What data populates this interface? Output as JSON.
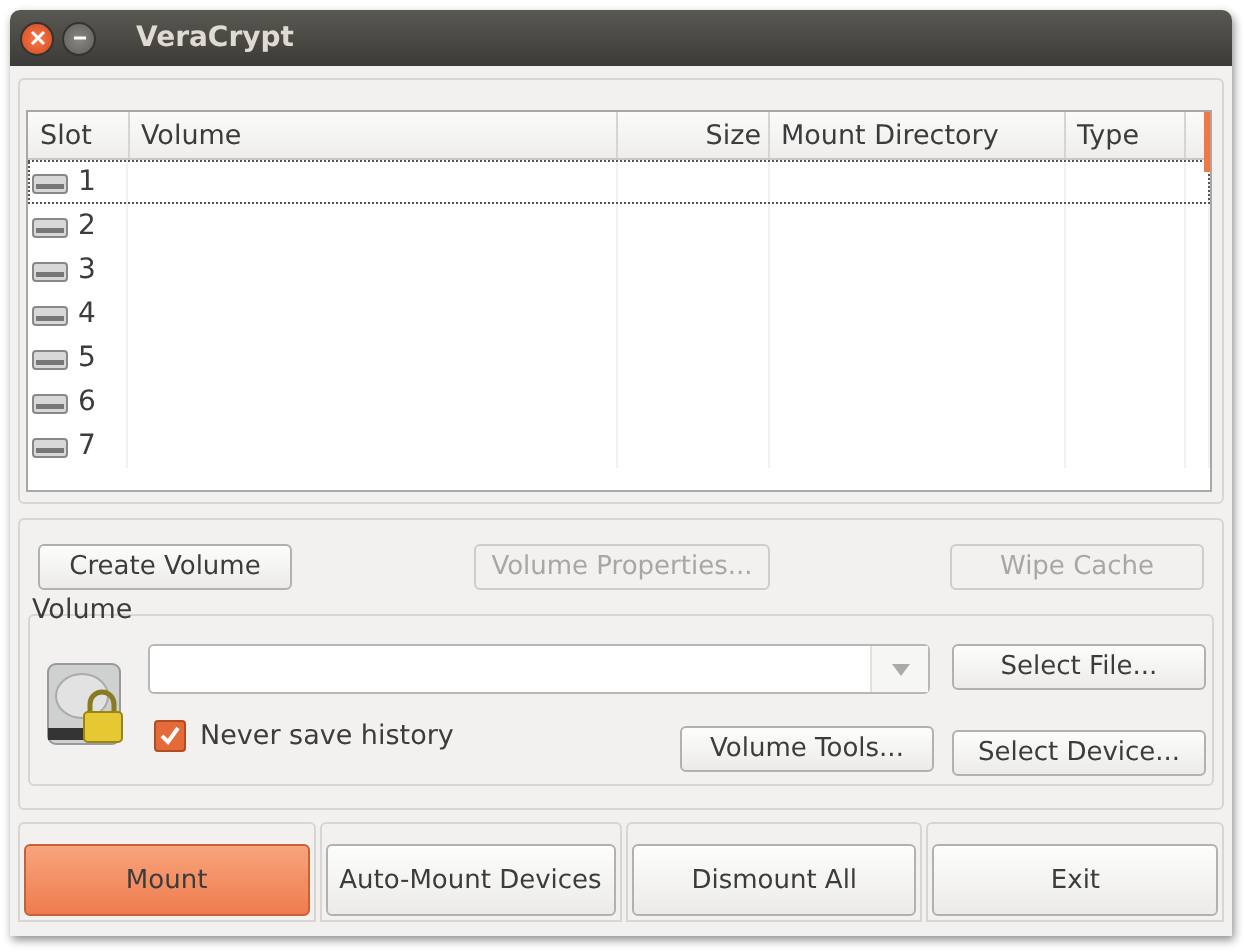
{
  "window": {
    "title": "VeraCrypt"
  },
  "table": {
    "columns": [
      "Slot",
      "Volume",
      "Size",
      "Mount Directory",
      "Type"
    ],
    "rows": [
      {
        "slot": "1",
        "selected": true
      },
      {
        "slot": "2",
        "selected": false
      },
      {
        "slot": "3",
        "selected": false
      },
      {
        "slot": "4",
        "selected": false
      },
      {
        "slot": "5",
        "selected": false
      },
      {
        "slot": "6",
        "selected": false
      },
      {
        "slot": "7",
        "selected": false
      }
    ]
  },
  "actions": [
    {
      "label": "Create Volume",
      "disabled": false
    },
    {
      "label": "Volume Properties...",
      "disabled": true
    },
    {
      "label": "Wipe Cache",
      "disabled": true
    }
  ],
  "volume": {
    "legend": "Volume",
    "never_save_history": {
      "label": "Never save history",
      "checked": true
    },
    "select_file": "Select File...",
    "volume_tools": "Volume Tools...",
    "select_device": "Select Device..."
  },
  "bottom_buttons": [
    {
      "label": "Mount",
      "default": true
    },
    {
      "label": "Auto-Mount Devices",
      "default": false
    },
    {
      "label": "Dismount All",
      "default": false
    },
    {
      "label": "Exit",
      "default": false
    }
  ]
}
